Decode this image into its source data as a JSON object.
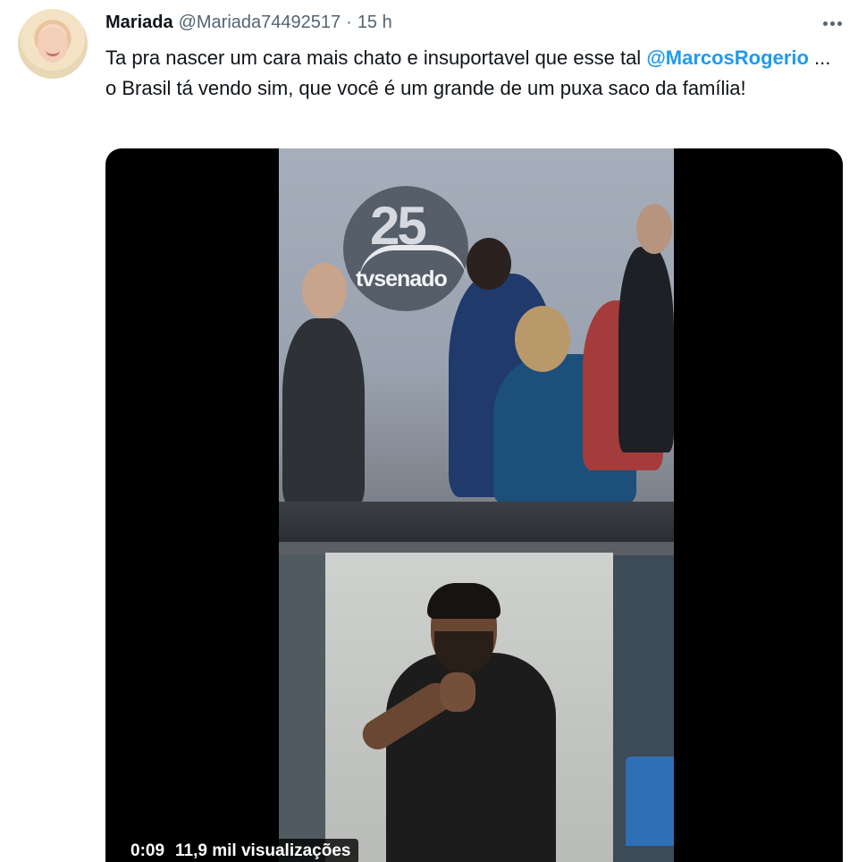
{
  "tweet": {
    "author_name": "Mariada",
    "author_handle": "@Mariada74492517",
    "separator": "·",
    "time_ago": "15 h",
    "text_part1": "Ta pra nascer um cara mais chato e insuportavel que esse tal ",
    "mention": "@MarcosRogerio",
    "text_part2": " ... o Brasil tá  vendo sim, que você é um grande de um puxa saco da família!"
  },
  "video": {
    "logo_number": "25",
    "logo_text": "tvsenado",
    "duration": "0:09",
    "views": "11,9 mil visualizações"
  },
  "icons": {
    "more": "more-horizontal-icon"
  },
  "colors": {
    "link": "#1d9bf0",
    "secondary_text": "#536471",
    "primary_text": "#0f1419"
  }
}
